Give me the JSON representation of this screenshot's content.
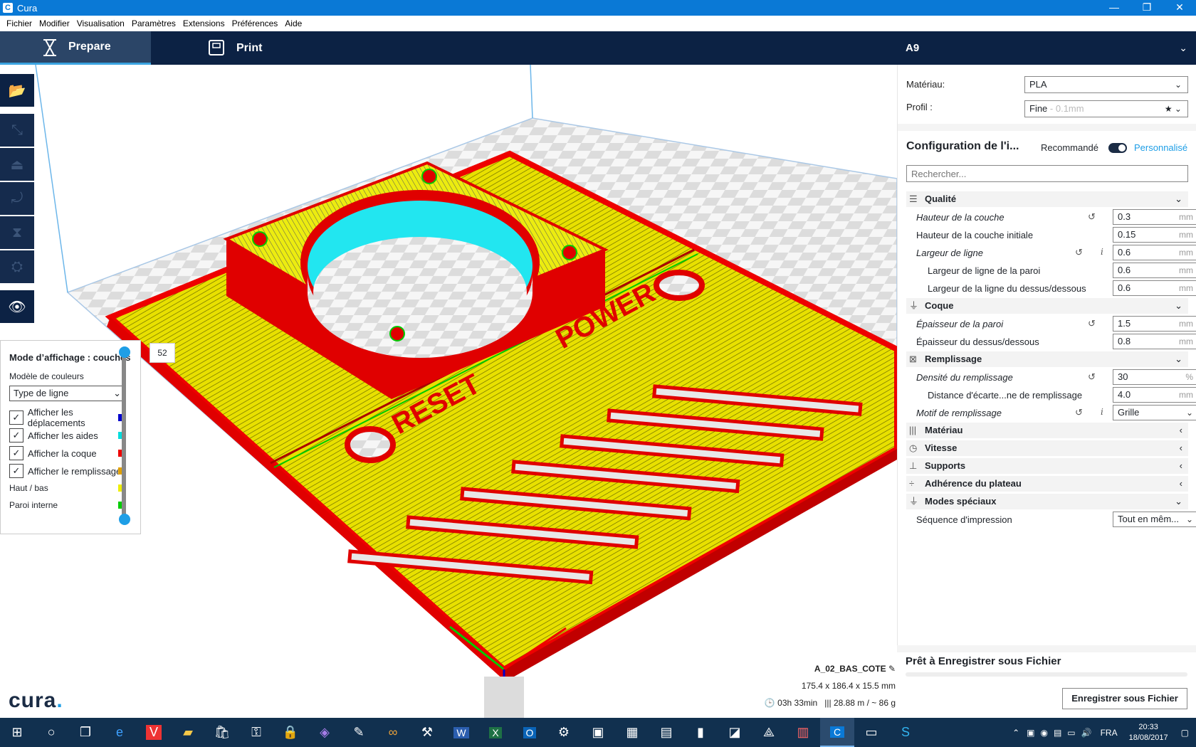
{
  "window": {
    "app_icon": "C",
    "title": "Cura"
  },
  "menu": [
    "Fichier",
    "Modifier",
    "Visualisation",
    "Paramètres",
    "Extensions",
    "Préférences",
    "Aide"
  ],
  "tabs": {
    "prepare": "Prepare",
    "print": "Print"
  },
  "printer": "A9",
  "material": {
    "label": "Matériau:",
    "value": "PLA"
  },
  "profile": {
    "label": "Profil :",
    "value": "Fine",
    "hint": "- 0.1mm"
  },
  "config": {
    "title": "Configuration de l'i...",
    "recommended": "Recommandé",
    "custom": "Personnalisé",
    "search_placeholder": "Rechercher..."
  },
  "categories": {
    "qualite": "Qualité",
    "coque": "Coque",
    "remplissage": "Remplissage",
    "materiau": "Matériau",
    "vitesse": "Vitesse",
    "supports": "Supports",
    "adherence": "Adhérence du plateau",
    "modes": "Modes spéciaux"
  },
  "settings": [
    {
      "name": "Hauteur de la couche",
      "value": "0.3",
      "unit": "mm"
    },
    {
      "name": "Hauteur de la couche initiale",
      "value": "0.15",
      "unit": "mm"
    },
    {
      "name": "Largeur de ligne",
      "value": "0.6",
      "unit": "mm"
    },
    {
      "name": "Largeur de ligne de la paroi",
      "value": "0.6",
      "unit": "mm"
    },
    {
      "name": "Largeur de la ligne du dessus/dessous",
      "value": "0.6",
      "unit": "mm"
    },
    {
      "name": "Épaisseur de la paroi",
      "value": "1.5",
      "unit": "mm"
    },
    {
      "name": "Épaisseur du dessus/dessous",
      "value": "0.8",
      "unit": "mm"
    },
    {
      "name": "Densité du remplissage",
      "value": "30",
      "unit": "%"
    },
    {
      "name": "Distance d'écarte...ne de remplissage",
      "value": "4.0",
      "unit": "mm"
    },
    {
      "name": "Motif de remplissage",
      "value": "Grille"
    },
    {
      "name": "Séquence d'impression",
      "value": "Tout en mêm..."
    }
  ],
  "legend": {
    "title": "Mode d’affichage : couches",
    "color_model_label": "Modèle de couleurs",
    "color_model_value": "Type de ligne",
    "checks": [
      {
        "label": "Afficher les déplacements",
        "color": "#0000cc"
      },
      {
        "label": "Afficher les aides",
        "color": "#00dddd"
      },
      {
        "label": "Afficher la coque",
        "color": "#ee0000"
      },
      {
        "label": "Afficher le remplissage",
        "color": "#e0a000"
      }
    ],
    "rows": [
      {
        "label": "Haut / bas",
        "color": "#eeee00"
      },
      {
        "label": "Paroi interne",
        "color": "#00cc00"
      }
    ],
    "layer": "52"
  },
  "viewport": {
    "labels": [
      "RESET",
      "POWER"
    ]
  },
  "job": {
    "name": "A_02_BAS_COTE",
    "dims": "175.4 x 186.4 x 15.5 mm",
    "time": "03h 33min",
    "material_use": "28.88 m / ~ 86 g"
  },
  "save": {
    "status": "Prêt à Enregistrer sous Fichier",
    "button": "Enregistrer sous Fichier"
  },
  "logo": {
    "text": "cura",
    "dot": "."
  },
  "tray": {
    "lang": "FRA",
    "time": "20:33",
    "date": "18/08/2017"
  }
}
